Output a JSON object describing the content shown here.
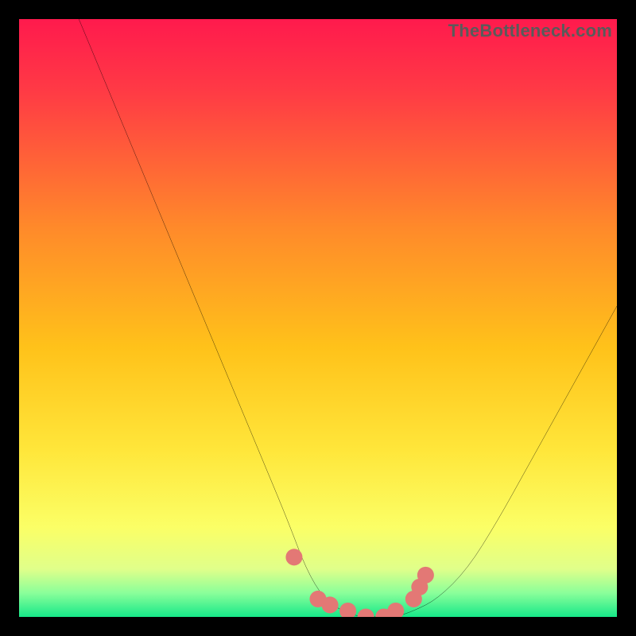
{
  "watermark": "TheBottleneck.com",
  "colors": {
    "bg_black": "#000000",
    "grad_top": "#ff1a4d",
    "grad_mid": "#ffd400",
    "grad_low": "#ffff88",
    "grad_bottom": "#17ff89",
    "curve": "#000000",
    "marker": "#e37875"
  },
  "chart_data": {
    "type": "line",
    "title": "",
    "xlabel": "",
    "ylabel": "",
    "xlim": [
      0,
      100
    ],
    "ylim": [
      0,
      100
    ],
    "series": [
      {
        "name": "bottleneck-curve",
        "x": [
          10,
          15,
          20,
          25,
          30,
          35,
          40,
          45,
          48,
          51,
          54,
          57,
          60,
          63,
          66,
          70,
          75,
          80,
          85,
          90,
          95,
          100
        ],
        "values": [
          100,
          88,
          76,
          64,
          52,
          40,
          28,
          16,
          8,
          3,
          1,
          0,
          0,
          0,
          1,
          3,
          8,
          16,
          25,
          34,
          43,
          52
        ]
      }
    ],
    "markers": {
      "name": "sampled-points",
      "x": [
        46,
        50,
        52,
        55,
        58,
        61,
        63,
        66,
        67,
        68
      ],
      "values": [
        10,
        3,
        2,
        1,
        0,
        0,
        1,
        3,
        5,
        7
      ]
    },
    "legend": false,
    "grid": false
  }
}
